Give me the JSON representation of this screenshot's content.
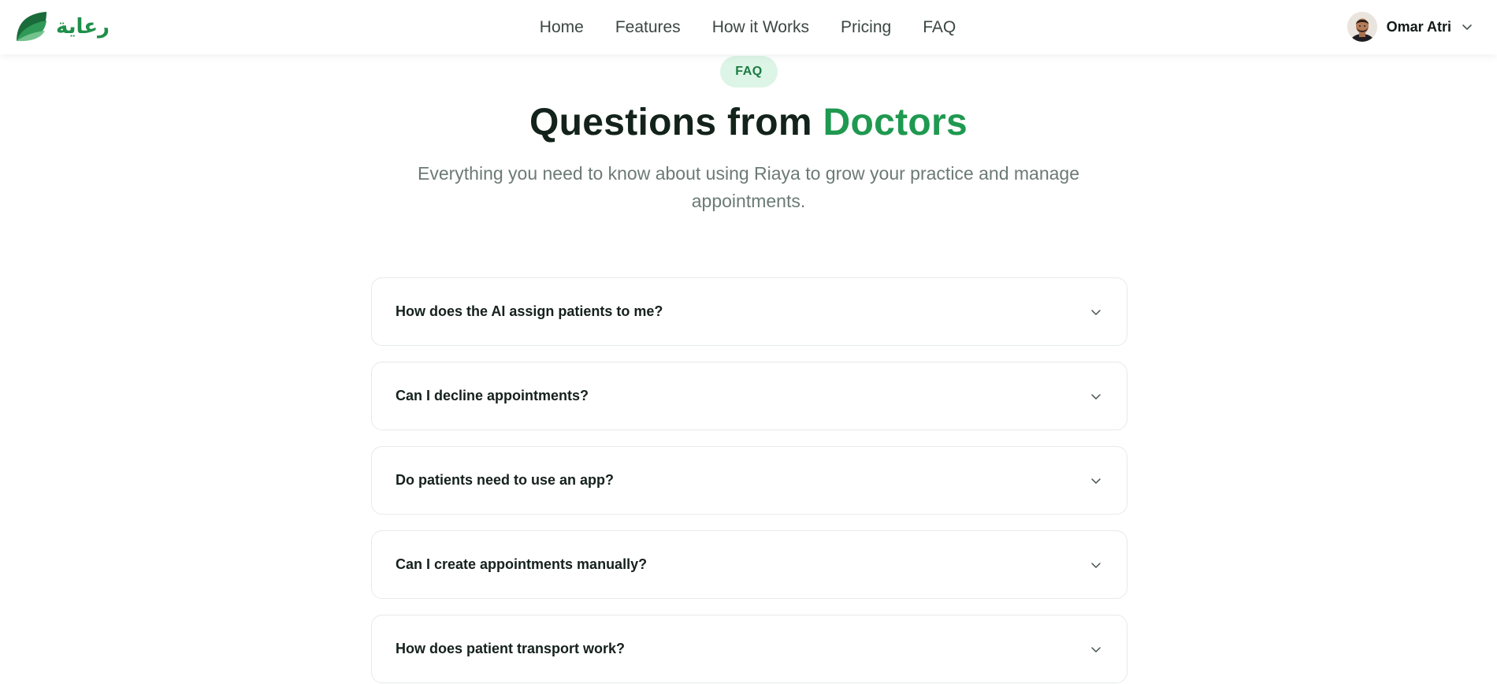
{
  "brand": {
    "name": "رعاية",
    "logo_icon": "leaf-logo-icon",
    "colors": {
      "primary": "#1f8f4a",
      "dark": "#1a6b3a",
      "light": "#56b878"
    }
  },
  "nav": {
    "links": [
      "Home",
      "Features",
      "How it Works",
      "Pricing",
      "FAQ"
    ]
  },
  "user": {
    "name": "Omar Atri",
    "menu_icon": "chevron-down-icon"
  },
  "hero": {
    "badge": "FAQ",
    "title_main": "Questions from ",
    "title_accent": "Doctors",
    "subtitle": "Everything you need to know about using Riaya to grow your practice and manage appointments.",
    "accent_color": "#1f9950"
  },
  "faq": {
    "items": [
      {
        "question": "How does the AI assign patients to me?"
      },
      {
        "question": "Can I decline appointments?"
      },
      {
        "question": "Do patients need to use an app?"
      },
      {
        "question": "Can I create appointments manually?"
      },
      {
        "question": "How does patient transport work?"
      }
    ]
  }
}
